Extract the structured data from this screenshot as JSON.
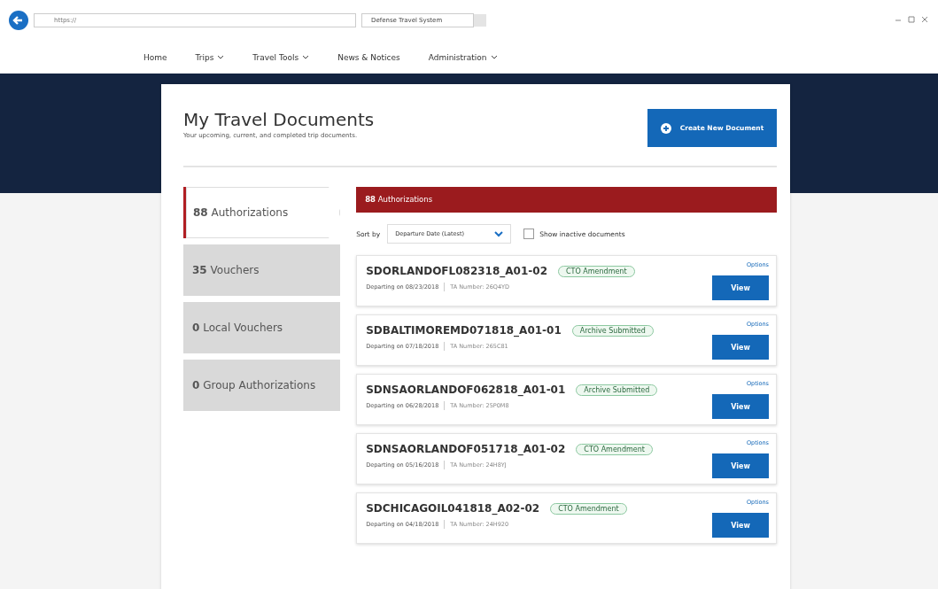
{
  "browser": {
    "address": "https://",
    "tab_title": "Defense Travel System"
  },
  "nav": [
    {
      "label": "Home",
      "dropdown": false
    },
    {
      "label": "Trips",
      "dropdown": true
    },
    {
      "label": "Travel Tools",
      "dropdown": true
    },
    {
      "label": "News & Notices",
      "dropdown": false
    },
    {
      "label": "Administration",
      "dropdown": true
    }
  ],
  "page": {
    "title": "My Travel Documents",
    "subtitle": "Your upcoming, current, and completed trip documents.",
    "create_button": "Create New Document"
  },
  "tabs": [
    {
      "label": "**88** Authorizations",
      "selected": true
    },
    {
      "label": "**35** Vouchers",
      "selected": false
    },
    {
      "label": "**0** Local Vouchers",
      "selected": false
    },
    {
      "label": "**0** Group Authorizations",
      "selected": false
    }
  ],
  "panel": {
    "header": "**88** Authorizations",
    "sort_label": "Sort by",
    "sort_value": "Departure Date (Latest)",
    "inactive_checkbox": {
      "label": "Show inactive documents",
      "checked": false
    }
  },
  "documents": [
    {
      "name": "SDORLANDOFL082318_A01-02",
      "status": "CTO Amendment",
      "departing": "Departing on 08/23/2018",
      "ta_number": "TA Number: 26Q4YD",
      "options": "Options",
      "view": "View"
    },
    {
      "name": "SDBALTIMOREMD071818_A01-01",
      "status": "Archive Submitted",
      "departing": "Departing on 07/18/2018",
      "ta_number": "TA Number: 265C81",
      "options": "Options",
      "view": "View"
    },
    {
      "name": "SDNSAORLANDOF062818_A01-01",
      "status": "Archive Submitted",
      "departing": "Departing on 06/28/2018",
      "ta_number": "TA Number: 25P0M8",
      "options": "Options",
      "view": "View"
    },
    {
      "name": "SDNSAORLANDOF051718_A01-02",
      "status": "CTO Amendment",
      "departing": "Departing on 05/16/2018",
      "ta_number": "TA Number: 24H8YJ",
      "options": "Options",
      "view": "View"
    },
    {
      "name": "SDCHICAGOIL041818_A02-02",
      "status": "CTO Amendment",
      "departing": "Departing on 04/18/2018",
      "ta_number": "TA Number: 24H920",
      "options": "Options",
      "view": "View"
    }
  ]
}
